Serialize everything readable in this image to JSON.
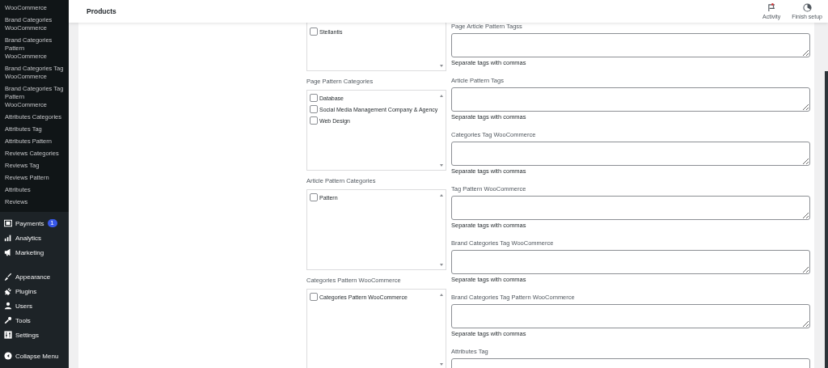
{
  "sidebar": {
    "submenu": [
      "WooCommerce",
      "Brand Categories WooCommerce",
      "Brand Categories Pattern WooCommerce",
      "Brand Categories Tag WooCommerce",
      "Brand Categories Tag Pattern WooCommerce",
      "Attributes Categories",
      "Attributes Tag",
      "Attributes Pattern",
      "Reviews Categories",
      "Reviews Tag",
      "Reviews Pattern",
      "Attributes",
      "Reviews"
    ],
    "menu_groups": [
      [
        {
          "label": "Payments",
          "badge": "1"
        },
        {
          "label": "Analytics"
        },
        {
          "label": "Marketing"
        }
      ],
      [
        {
          "label": "Appearance"
        },
        {
          "label": "Plugins"
        },
        {
          "label": "Users"
        },
        {
          "label": "Tools"
        },
        {
          "label": "Settings"
        }
      ]
    ],
    "collapse": "Collapse Menu"
  },
  "header": {
    "title": "Products",
    "actions": [
      {
        "label": "Activity",
        "notification": true
      },
      {
        "label": "Finish setup",
        "notification": false
      }
    ]
  },
  "category_boxes": [
    {
      "items": [
        {
          "label": "Stellantis",
          "checked": false
        }
      ]
    },
    {
      "label": "Page Pattern Categories",
      "items": [
        {
          "label": "Database",
          "checked": false
        },
        {
          "label": "Social Media Management Company & Agency",
          "checked": false
        },
        {
          "label": "Web Design",
          "checked": false
        }
      ]
    },
    {
      "label": "Article Pattern Categories",
      "items": [
        {
          "label": "Pattern",
          "checked": false
        }
      ]
    },
    {
      "label": "Categories Pattern WooCommerce",
      "items": [
        {
          "label": "Categories Pattern WooCommerce",
          "checked": false
        }
      ]
    }
  ],
  "tag_fields": [
    {
      "label": "Page Article Pattern Tagss",
      "help": "Separate tags with commas"
    },
    {
      "label": "Article Pattern Tags",
      "help": "Separate tags with commas"
    },
    {
      "label": "Categories Tag WooCommerce",
      "help": "Separate tags with commas"
    },
    {
      "label": "Tag Pattern WooCommerce",
      "help": "Separate tags with commas"
    },
    {
      "label": "Brand Categories Tag WooCommerce",
      "help": "Separate tags with commas"
    },
    {
      "label": "Brand Categories Tag Pattern WooCommerce",
      "help": "Separate tags with commas"
    },
    {
      "label": "Attributes Tag"
    }
  ]
}
